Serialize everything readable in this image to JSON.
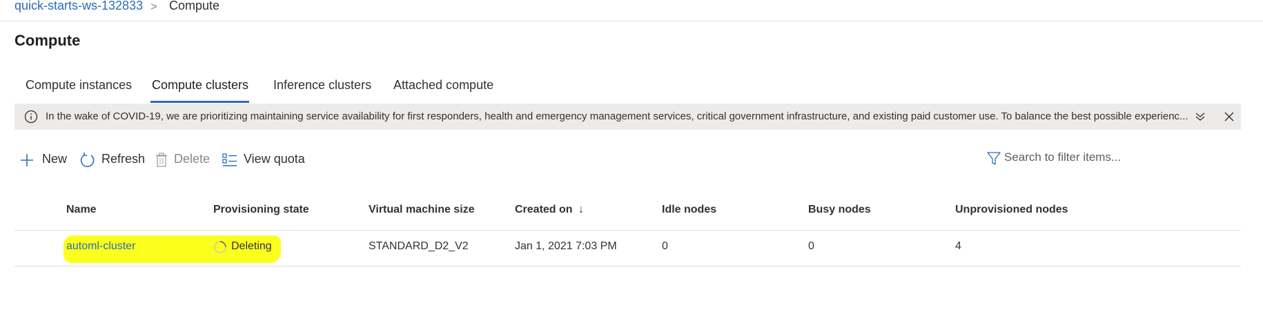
{
  "breadcrumb": {
    "workspace": "quick-starts-ws-132833",
    "separator": ">",
    "current": "Compute"
  },
  "page_title": "Compute",
  "tabs": [
    {
      "label": "Compute instances",
      "selected": false
    },
    {
      "label": "Compute clusters",
      "selected": true
    },
    {
      "label": "Inference clusters",
      "selected": false
    },
    {
      "label": "Attached compute",
      "selected": false
    }
  ],
  "banner": {
    "text": "In the wake of COVID-19, we are prioritizing maintaining service availability for first responders, health and emergency management services, critical government infrastructure, and existing paid customer use. To balance the best possible experienc...",
    "icon": "info-icon"
  },
  "toolbar": {
    "new_label": "New",
    "refresh_label": "Refresh",
    "delete_label": "Delete",
    "view_quota_label": "View quota",
    "search_placeholder": "Search to filter items..."
  },
  "table": {
    "columns": [
      "Name",
      "Provisioning state",
      "Virtual machine size",
      "Created on",
      "Idle nodes",
      "Busy nodes",
      "Unprovisioned nodes"
    ],
    "sort_indicator": "↓",
    "rows": [
      {
        "name": "automl-cluster",
        "state": "Deleting",
        "vm_size": "STANDARD_D2_V2",
        "created_on": "Jan 1, 2021 7:03 PM",
        "idle_nodes": "0",
        "busy_nodes": "0",
        "unprovisioned_nodes": "4"
      }
    ]
  },
  "colors": {
    "accent": "#2b6cb7",
    "banner_bg": "#edebe9",
    "highlight": "#fbff1c"
  }
}
